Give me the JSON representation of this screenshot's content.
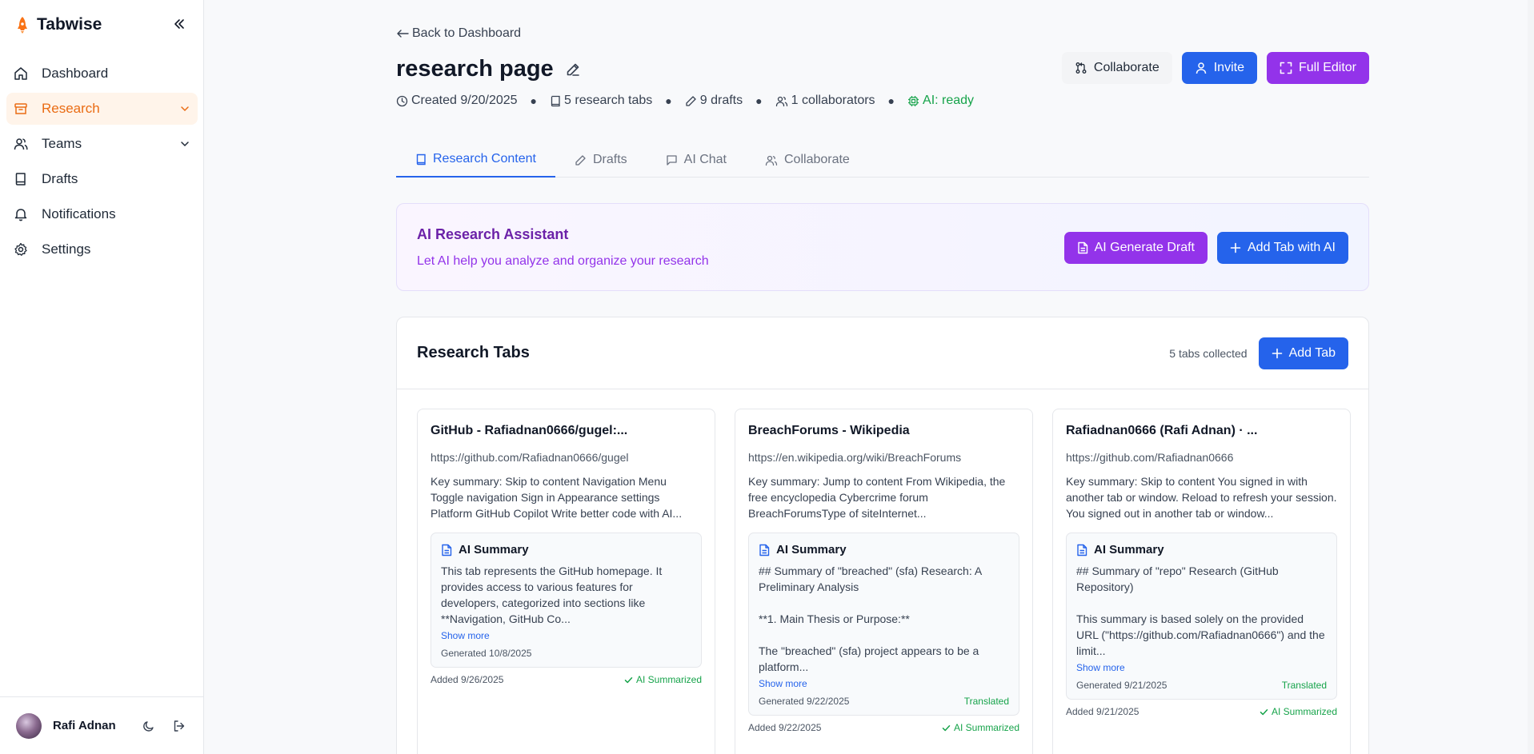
{
  "app": {
    "name": "Tabwise"
  },
  "sidebar": {
    "items": [
      {
        "label": "Dashboard",
        "icon": "home-icon"
      },
      {
        "label": "Research",
        "icon": "archive-icon",
        "active": true
      },
      {
        "label": "Teams",
        "icon": "users-icon"
      },
      {
        "label": "Drafts",
        "icon": "book-icon"
      },
      {
        "label": "Notifications",
        "icon": "bell-icon"
      },
      {
        "label": "Settings",
        "icon": "gear-icon"
      }
    ],
    "user": {
      "name": "Rafi Adnan"
    }
  },
  "header": {
    "back_label": "Back to Dashboard",
    "title": "research page",
    "meta": {
      "created": "Created 9/20/2025",
      "tabs": "5 research tabs",
      "drafts": "9 drafts",
      "collaborators": "1 collaborators",
      "ai": "AI: ready"
    },
    "actions": {
      "collaborate": "Collaborate",
      "invite": "Invite",
      "full_editor": "Full Editor"
    }
  },
  "tabs": [
    {
      "label": "Research Content",
      "active": true
    },
    {
      "label": "Drafts"
    },
    {
      "label": "AI Chat"
    },
    {
      "label": "Collaborate"
    }
  ],
  "assistant": {
    "title": "AI Research Assistant",
    "subtitle": "Let AI help you analyze and organize your research",
    "generate_label": "AI Generate Draft",
    "add_label": "Add Tab with AI"
  },
  "research_tabs": {
    "title": "Research Tabs",
    "count": "5 tabs collected",
    "add_label": "Add Tab",
    "cards": [
      {
        "title": "GitHub - Rafiadnan0666/gugel:...",
        "url": "https://github.com/Rafiadnan0666/gugel",
        "key": "Key summary: Skip to content Navigation Menu Toggle navigation Sign in Appearance settings Platform GitHub Copilot Write better code with AI...",
        "summary_label": "AI Summary",
        "summary": "This tab represents the GitHub homepage. It provides access to various features for developers, categorized into sections like **Navigation, GitHub Co...",
        "show_more": "Show more",
        "generated": "Generated 10/8/2025",
        "translated": "",
        "added": "Added 9/26/2025",
        "status": "AI Summarized"
      },
      {
        "title": "BreachForums - Wikipedia",
        "url": "https://en.wikipedia.org/wiki/BreachForums",
        "key": "Key summary: Jump to content From Wikipedia, the free encyclopedia Cybercrime forum BreachForumsType of siteInternet...",
        "summary_label": "AI Summary",
        "summary": "## Summary of \"breached\" (sfa) Research: A Preliminary Analysis\n\n**1. Main Thesis or Purpose:**\n\nThe \"breached\" (sfa) project appears to be a platform...",
        "show_more": "Show more",
        "generated": "Generated 9/22/2025",
        "translated": "Translated",
        "added": "Added 9/22/2025",
        "status": "AI Summarized"
      },
      {
        "title": "Rafiadnan0666 (Rafi Adnan) · ...",
        "url": "https://github.com/Rafiadnan0666",
        "key": "Key summary: Skip to content You signed in with another tab or window. Reload to refresh your session. You signed out in another tab or window...",
        "summary_label": "AI Summary",
        "summary": "## Summary of \"repo\" Research (GitHub Repository)\n\nThis summary is based solely on the provided URL (\"https://github.com/Rafiadnan0666\") and the limit...",
        "show_more": "Show more",
        "generated": "Generated 9/21/2025",
        "translated": "Translated",
        "added": "Added 9/21/2025",
        "status": "AI Summarized"
      }
    ]
  },
  "colors": {
    "accent_orange": "#ea6c14",
    "blue": "#2563eb",
    "purple": "#9333ea",
    "green": "#16a34a"
  }
}
